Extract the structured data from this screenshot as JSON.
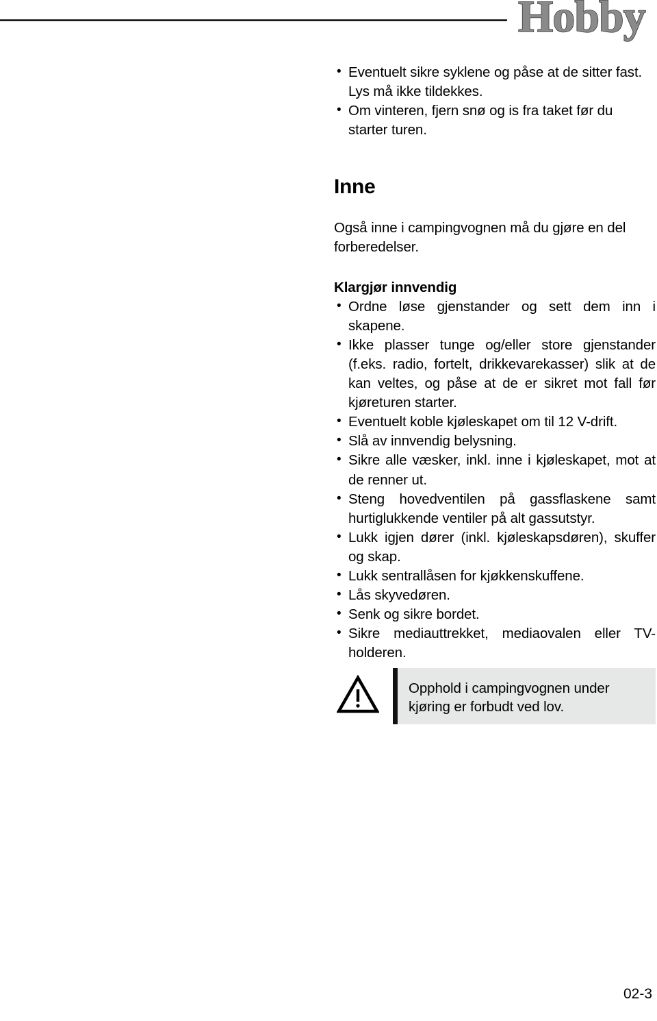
{
  "header": {
    "brand": "Hobby",
    "rule_color": "#1a1a1a",
    "brand_color": "#8a8a8a"
  },
  "content": {
    "top_bullets": [
      "Eventuelt sikre syklene og påse at de sitter fast. Lys må ikke tildekkes.",
      "Om vinteren, fjern snø og is fra taket før du starter turen."
    ],
    "section_heading": "Inne",
    "intro_paragraph": "Også inne i campingvognen må du gjøre en del forberedelser.",
    "sub_heading": "Klargjør innvendig",
    "main_bullets": [
      "Ordne løse gjenstander og sett dem inn i skapene.",
      "Ikke plasser tunge og/eller store gjenstander (f.eks. radio, fortelt, drikkevarekasser) slik at de kan veltes, og påse at de er sikret mot fall før kjøreturen starter.",
      "Eventuelt koble kjøleskapet om til 12 V-drift.",
      "Slå av innvendig belysning.",
      "Sikre alle væsker, inkl. inne i kjøleskapet, mot at de renner ut.",
      "Steng hovedventilen på gassflaskene samt hurtiglukkende ventiler på alt gassutstyr.",
      "Lukk igjen dører (inkl. kjøleskapsdøren), skuffer og skap.",
      "Lukk sentrallåsen for kjøkkenskuffene.",
      "Lås skyvedøren.",
      "Senk og sikre bordet.",
      "Sikre mediauttrekket, mediaovalen eller TV-holderen."
    ]
  },
  "warning": {
    "icon": "warning-triangle-icon",
    "text": "Opphold i campingvognen under kjøring er forbudt ved lov.",
    "background_color": "#e6e8e8",
    "bar_color": "#111111"
  },
  "footer": {
    "page_number": "02-3"
  }
}
